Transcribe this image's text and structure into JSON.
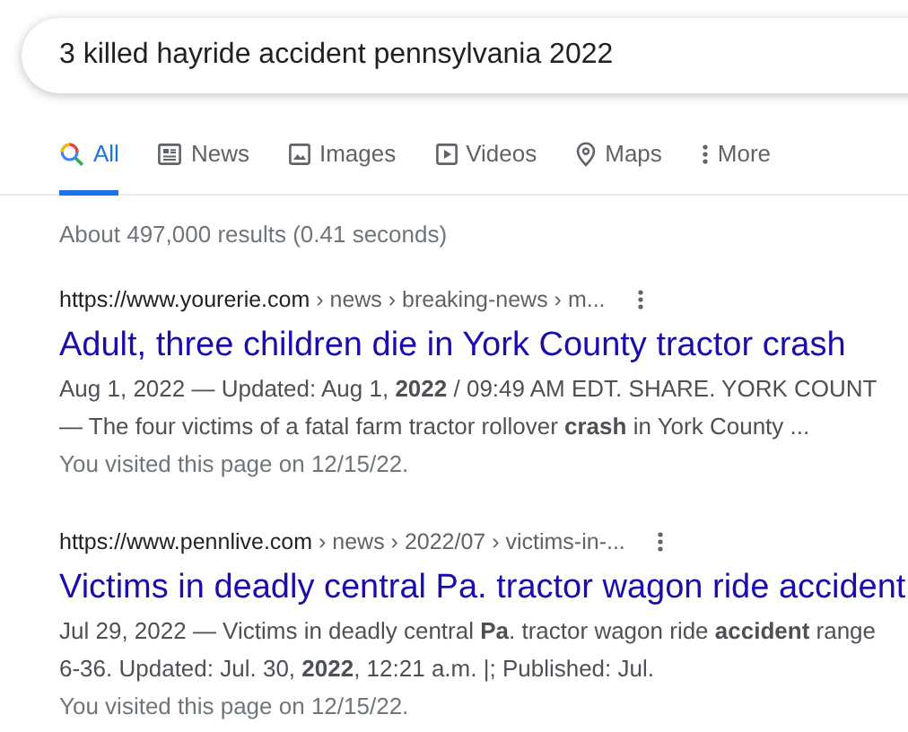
{
  "search": {
    "value": "3 killed hayride accident pennsylvania 2022"
  },
  "tabs": [
    {
      "label": "All",
      "kind": "all",
      "selected": true
    },
    {
      "label": "News",
      "kind": "news",
      "selected": false
    },
    {
      "label": "Images",
      "kind": "images",
      "selected": false
    },
    {
      "label": "Videos",
      "kind": "videos",
      "selected": false
    },
    {
      "label": "Maps",
      "kind": "maps",
      "selected": false
    },
    {
      "label": "More",
      "kind": "more",
      "selected": false
    }
  ],
  "result_stats": "About 497,000 results (0.41 seconds)",
  "results": [
    {
      "url": "https://www.yourerie.com",
      "path": " › news › breaking-news › m...",
      "title": "Adult, three children die in York County tractor crash",
      "snippet_lines": [
        "Aug 1, 2022 — Updated: Aug 1, **2022** / 09:49 AM EDT. SHARE. YORK COUNT",
        "— The four victims of a fatal farm tractor rollover **crash** in York County ..."
      ],
      "visited": "You visited this page on 12/15/22."
    },
    {
      "url": "https://www.pennlive.com",
      "path": " › news › 2022/07 › victims-in-...",
      "title": "Victims in deadly central Pa. tractor wagon ride accident",
      "snippet_lines": [
        "Jul 29, 2022 — Victims in deadly central **Pa**. tractor wagon ride **accident** range",
        "6-36. Updated: Jul. 30, **2022**, 12:21 a.m. |; Published: Jul."
      ],
      "visited": "You visited this page on 12/15/22."
    }
  ]
}
